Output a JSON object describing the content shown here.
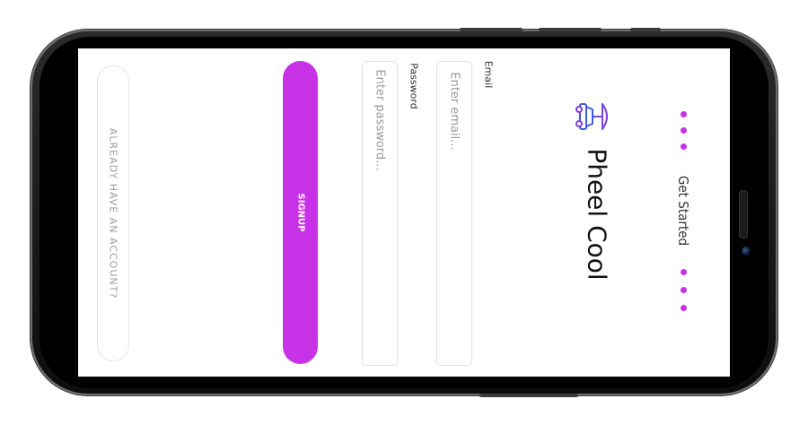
{
  "header": {
    "title": "Get Started",
    "app_name": "Pheel Cool",
    "logo_icon": "car-umbrella-logo-icon"
  },
  "form": {
    "email_label": "Email",
    "email_placeholder": "Enter email...",
    "password_label": "Password",
    "password_placeholder": "Enter password...",
    "signup_label": "SIGNUP",
    "account_link_label": "ALREADY HAVE AN ACCOUNT?"
  },
  "colors": {
    "accent": "#c832e6",
    "logo_purple": "#7b3fe4",
    "logo_blue": "#3b5bdb"
  }
}
